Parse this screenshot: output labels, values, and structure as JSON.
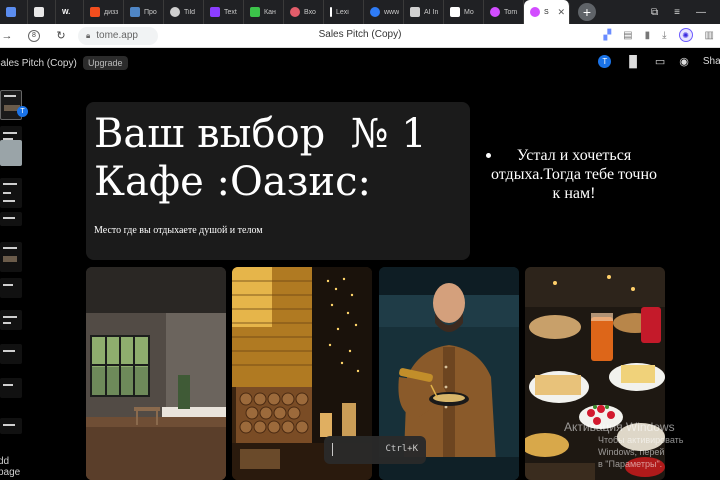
{
  "browser": {
    "tabs": [
      {
        "label": "",
        "favicon_color": "#5b8def"
      },
      {
        "label": "",
        "favicon_color": "#e8e8e8"
      },
      {
        "label": "W.",
        "favicon_color": "#ffffff"
      },
      {
        "label": "дизз",
        "favicon_color": "#f24e1e"
      },
      {
        "label": "Про",
        "favicon_color": "#4f86c6"
      },
      {
        "label": "Tild",
        "favicon_color": "#cfcfcf"
      },
      {
        "label": "Text",
        "favicon_color": "#8b3dff"
      },
      {
        "label": "Кан",
        "favicon_color": "#3cc34a"
      },
      {
        "label": "Вхо",
        "favicon_color": "#e35d6a"
      },
      {
        "label": "Lexi",
        "favicon_color": "#ffffff"
      },
      {
        "label": "www",
        "favicon_color": "#2f7cf6"
      },
      {
        "label": "AI In",
        "favicon_color": "#d0d0d0"
      },
      {
        "label": "Mo",
        "favicon_color": "#ffffff"
      },
      {
        "label": "Tom",
        "favicon_color": "#d24dff"
      },
      {
        "label": "S",
        "favicon_color": "#d24dff"
      }
    ],
    "new_tab_label": "+",
    "url": "tome.app",
    "page_title": "Sales Pitch (Copy)",
    "profile_initial": "",
    "window_controls": [
      "⧉",
      "≡",
      "—"
    ]
  },
  "app": {
    "doc_title": "Sales Pitch (Copy)",
    "upgrade_label": "Upgrade",
    "user_initial": "T",
    "share_label": "Shar",
    "add_page_label": "dd page",
    "thumb_badge": "T"
  },
  "slide": {
    "heading": "Ваш выбор  № 1\nКафе :Оазис:",
    "subtitle": "Место где вы отдыхаете душой и телом",
    "bullet": "Устал и хочеться отдыха.Тогда тебе точно к нам!"
  },
  "command": {
    "hint": "Ctrl+K"
  },
  "watermark": {
    "line1": "Активация Windows",
    "line2": "Чтобы активировать Windows, перей",
    "line3": "в \"Параметры\"."
  },
  "colors": {
    "accent": "#1a73e8",
    "background": "#000000",
    "card": "#1b1b1b"
  }
}
